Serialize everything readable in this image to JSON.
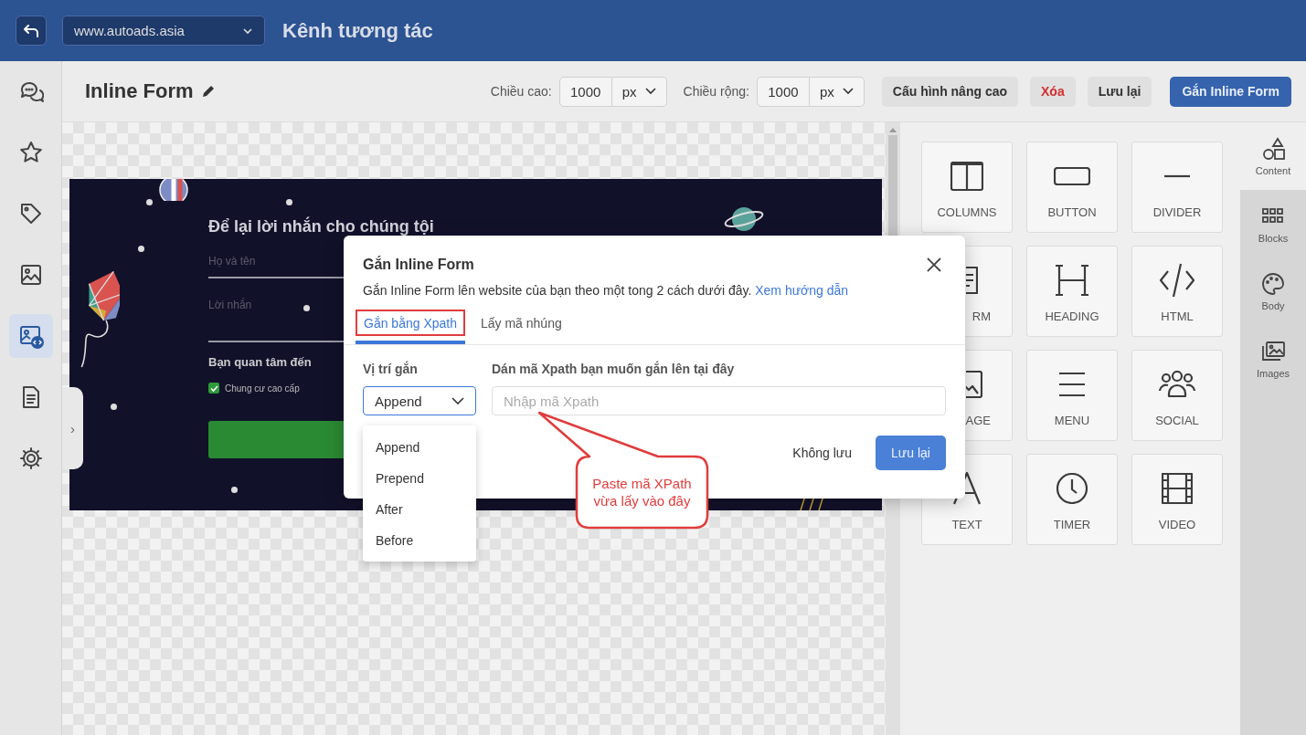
{
  "header": {
    "site_select": "www.autoads.asia",
    "title": "Kênh tương tác"
  },
  "sidebar": {
    "items": [
      {
        "kind": "chat",
        "selected": false
      },
      {
        "kind": "star",
        "selected": false
      },
      {
        "kind": "tag",
        "selected": false
      },
      {
        "kind": "image",
        "selected": false
      },
      {
        "kind": "image-code",
        "selected": true
      },
      {
        "kind": "document",
        "selected": false
      },
      {
        "kind": "gear",
        "selected": false
      }
    ]
  },
  "toolbar": {
    "title": "Inline Form",
    "height_label": "Chiều cao:",
    "height_value": "1000",
    "height_unit": "px",
    "width_label": "Chiều rộng:",
    "width_value": "1000",
    "width_unit": "px",
    "buttons": [
      {
        "label": "Cấu hình nâng cao",
        "kind": "secondary"
      },
      {
        "label": "Xóa",
        "kind": "danger"
      },
      {
        "label": "Lưu lại",
        "kind": "secondary"
      },
      {
        "label": "Gắn Inline Form",
        "kind": "primary"
      }
    ]
  },
  "canvas": {
    "collapse_toggle": "›",
    "form": {
      "heading": "Để lại lời nhắn cho chúng tội",
      "name_placeholder": "Họ và tên",
      "message_placeholder": "Lời nhắn",
      "interest_label": "Bạn quan tâm đến",
      "options": [
        {
          "label": "Chung cư cao cấp",
          "checked": true
        }
      ]
    }
  },
  "blocks": {
    "tiles": [
      {
        "kind": "columns",
        "label": "COLUMNS",
        "covered": false
      },
      {
        "kind": "button",
        "label": "BUTTON",
        "covered": false
      },
      {
        "kind": "divider",
        "label": "DIVIDER",
        "covered": false
      },
      {
        "kind": "form",
        "label": "RM",
        "covered": true
      },
      {
        "kind": "heading",
        "label": "HEADING",
        "covered": false
      },
      {
        "kind": "html",
        "label": "HTML",
        "covered": false
      },
      {
        "kind": "image",
        "label": "AGE",
        "covered": true
      },
      {
        "kind": "menu",
        "label": "MENU",
        "covered": false
      },
      {
        "kind": "social",
        "label": "SOCIAL",
        "covered": false
      },
      {
        "kind": "text",
        "label": "TEXT",
        "covered": false
      },
      {
        "kind": "timer",
        "label": "TIMER",
        "covered": false
      },
      {
        "kind": "video",
        "label": "VIDEO",
        "covered": false
      }
    ]
  },
  "right_tabs": [
    {
      "kind": "shapes",
      "label": "Content",
      "selected": true
    },
    {
      "kind": "blocks",
      "label": "Blocks",
      "selected": false
    },
    {
      "kind": "palette",
      "label": "Body",
      "selected": false
    },
    {
      "kind": "images",
      "label": "Images",
      "selected": false
    }
  ],
  "dialog": {
    "title": "Gắn Inline Form",
    "description": "Gắn Inline Form lên website của bạn theo một tong 2 cách dưới đây.",
    "help_link": "Xem hướng dẫn",
    "tabs": [
      {
        "label": "Gắn bằng Xpath",
        "selected": true,
        "highlighted": true
      },
      {
        "label": "Lấy mã nhúng",
        "selected": false,
        "highlighted": false
      }
    ],
    "position_label": "Vị trí gắn",
    "position_value": "Append",
    "position_options": [
      "Append",
      "Prepend",
      "After",
      "Before"
    ],
    "xpath_label": "Dán mã Xpath bạn muốn gắn lên tại đây",
    "xpath_placeholder": "Nhập mã Xpath",
    "cancel_button": "Không lưu",
    "save_button": "Lưu lại",
    "callout": "Paste mã XPath vừa lấy vào đây"
  }
}
